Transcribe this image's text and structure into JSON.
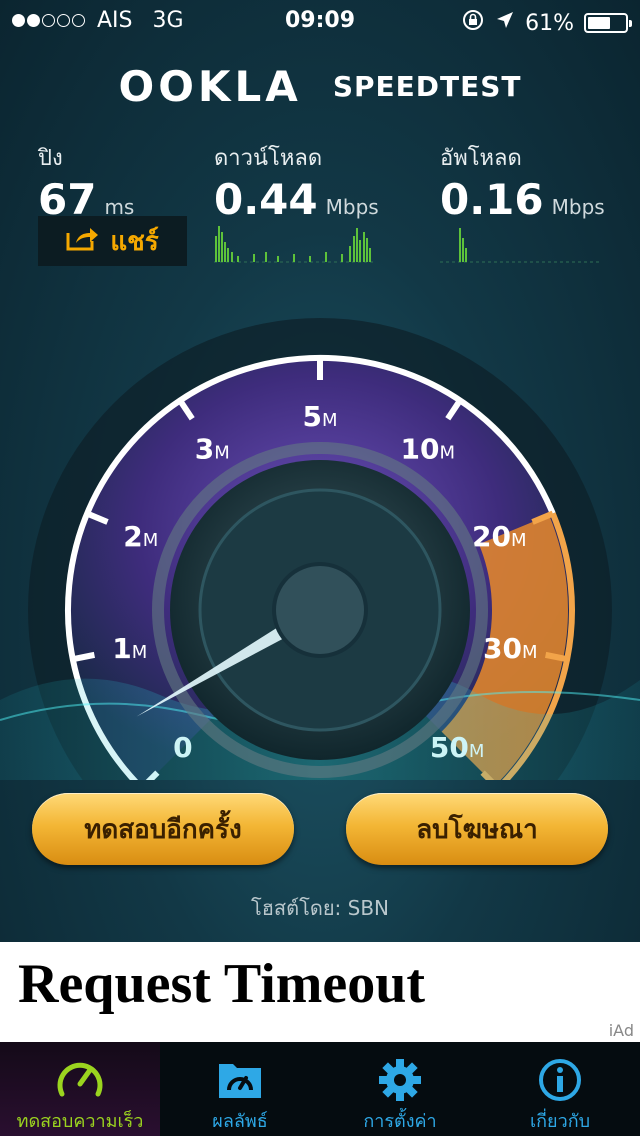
{
  "status_bar": {
    "carrier": "AIS",
    "network": "3G",
    "time": "09:09",
    "battery": "61%",
    "battery_level": 0.61,
    "signal_bars_filled": 2,
    "signal_bars_total": 5
  },
  "brand": {
    "logo": "OOKLA",
    "product": "SPEEDTEST"
  },
  "stats": {
    "ping": {
      "label": "ปิง",
      "value": "67",
      "unit": "ms"
    },
    "download": {
      "label": "ดาวน์โหลด",
      "value": "0.44",
      "unit": "Mbps"
    },
    "upload": {
      "label": "อัพโหลด",
      "value": "0.16",
      "unit": "Mbps"
    }
  },
  "share_label": "แชร์",
  "gauge": {
    "ticks": [
      "0",
      "1",
      "2",
      "3",
      "5",
      "10",
      "20",
      "30",
      "50"
    ],
    "unit": "M",
    "needle_value": 0.44
  },
  "buttons": {
    "retest": "ทดสอบอีกครั้ง",
    "remove_ads": "ลบโฆษณา"
  },
  "host": "โฮสต์โดย: SBN",
  "ad": {
    "text": "Request Timeout",
    "badge": "iAd"
  },
  "tabs": [
    {
      "label": "ทดสอบความเร็ว",
      "icon": "speedometer-icon",
      "active": true
    },
    {
      "label": "ผลลัพธ์",
      "icon": "results-folder-icon",
      "active": false
    },
    {
      "label": "การตั้งค่า",
      "icon": "gear-icon",
      "active": false
    },
    {
      "label": "เกี่ยวกับ",
      "icon": "info-icon",
      "active": false
    }
  ],
  "colors": {
    "accent_orange": "#f5a800",
    "tab_blue": "#2ea8e6",
    "tab_active_green": "#9bd41f",
    "gauge_purple": "#5a3d9c",
    "gauge_orange": "#e9892a"
  }
}
